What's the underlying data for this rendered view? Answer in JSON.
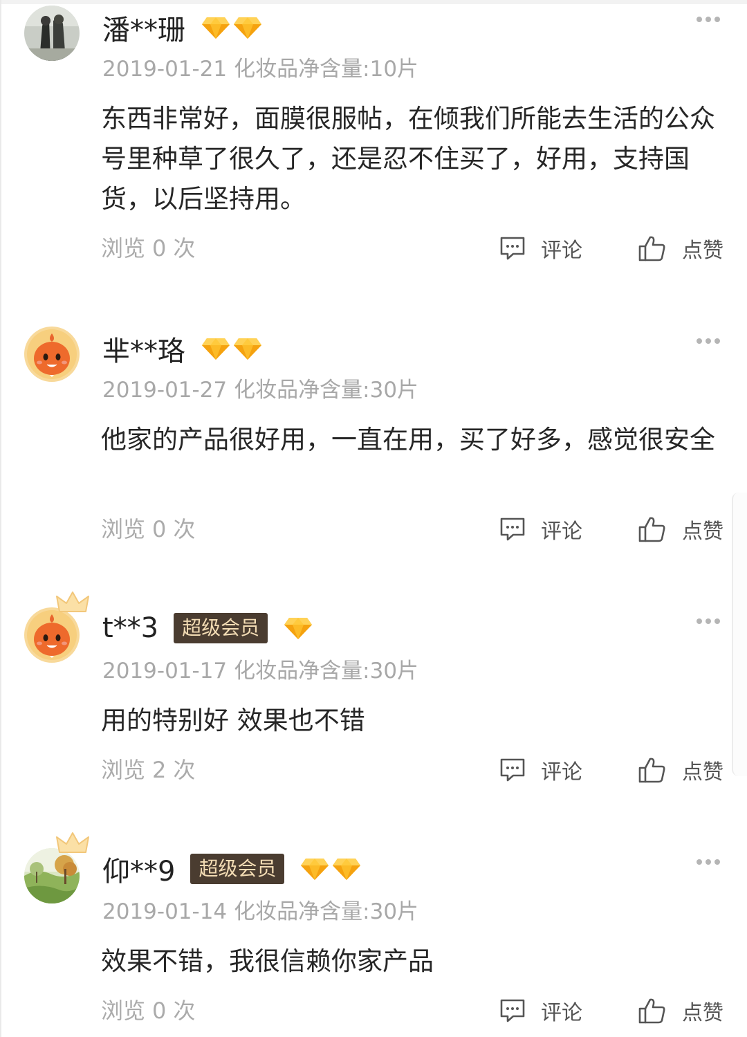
{
  "reviews": [
    {
      "username": "潘**珊",
      "vip_label": "",
      "date": "2019-01-21",
      "spec": "化妆品净含量:10片",
      "content": "东西非常好，面膜很服帖，在倾我们所能去生活的公众号里种草了很久了，还是忍不住买了，好用，支持国货，以后坚持用。",
      "views_label": "浏览",
      "views_count": "0",
      "views_unit": "次",
      "comment_label": "评论",
      "like_label": "点赞",
      "diamond_count": 2,
      "avatar": "photo-avatar-gray"
    },
    {
      "username": "芈**珞",
      "vip_label": "",
      "date": "2019-01-27",
      "spec": "化妆品净含量:30片",
      "content": "他家的产品很好用，一直在用，买了好多，感觉很安全",
      "views_label": "浏览",
      "views_count": "0",
      "views_unit": "次",
      "comment_label": "评论",
      "like_label": "点赞",
      "diamond_count": 2,
      "avatar": "orange-mascot-avatar"
    },
    {
      "username": "t**3",
      "vip_label": "超级会员",
      "date": "2019-01-17",
      "spec": "化妆品净含量:30片",
      "content": "用的特别好 效果也不错",
      "views_label": "浏览",
      "views_count": "2",
      "views_unit": "次",
      "comment_label": "评论",
      "like_label": "点赞",
      "diamond_count": 1,
      "avatar": "orange-mascot-avatar"
    },
    {
      "username": "仰**9",
      "vip_label": "超级会员",
      "date": "2019-01-14",
      "spec": "化妆品净含量:30片",
      "content": "效果不错，我很信赖你家产品",
      "views_label": "浏览",
      "views_count": "0",
      "views_unit": "次",
      "comment_label": "评论",
      "like_label": "点赞",
      "diamond_count": 2,
      "avatar": "landscape-photo-avatar"
    }
  ],
  "icons": {
    "more": "more-dots-icon",
    "comment": "comment-bubble-icon",
    "like": "thumbs-up-icon",
    "diamond": "diamond-icon",
    "crown": "crown-icon"
  },
  "colors": {
    "vip_badge_bg": "#4a3c30",
    "vip_badge_text": "#f3dcb4",
    "diamond": "#f9b51a",
    "meta_text": "#a8a8a8"
  }
}
